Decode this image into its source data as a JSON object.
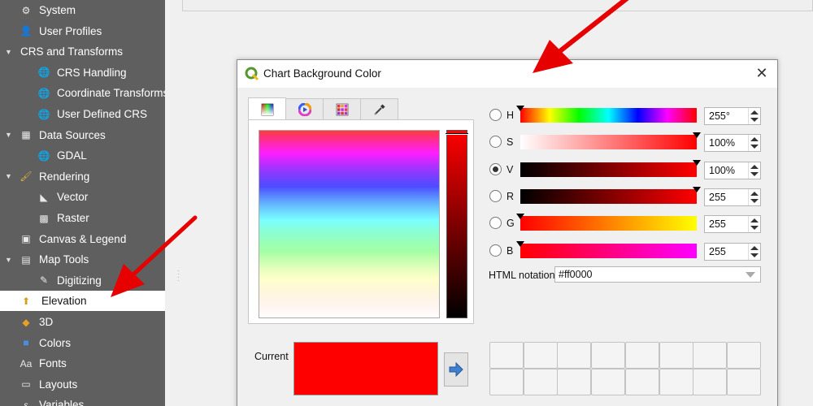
{
  "sidebar": {
    "items": [
      {
        "label": "System",
        "icon": "system-icon",
        "level": 1
      },
      {
        "label": "User Profiles",
        "icon": "user-icon",
        "level": 1
      },
      {
        "label": "CRS and Transforms",
        "icon": "none",
        "level": 0,
        "expanded": true
      },
      {
        "label": "CRS Handling",
        "icon": "globe-icon",
        "level": 2
      },
      {
        "label": "Coordinate Transforms",
        "icon": "globe-icon",
        "level": 2
      },
      {
        "label": "User Defined CRS",
        "icon": "globe-star-icon",
        "level": 2
      },
      {
        "label": "Data Sources",
        "icon": "table-icon",
        "level": 0,
        "expanded": true
      },
      {
        "label": "GDAL",
        "icon": "globe-icon",
        "level": 2
      },
      {
        "label": "Rendering",
        "icon": "brush-icon",
        "level": 0,
        "expanded": true
      },
      {
        "label": "Vector",
        "icon": "vector-icon",
        "level": 2
      },
      {
        "label": "Raster",
        "icon": "raster-icon",
        "level": 2
      },
      {
        "label": "Canvas & Legend",
        "icon": "canvas-icon",
        "level": 1
      },
      {
        "label": "Map Tools",
        "icon": "map-tools-icon",
        "level": 0,
        "expanded": true
      },
      {
        "label": "Digitizing",
        "icon": "digitizing-icon",
        "level": 2
      },
      {
        "label": "Elevation",
        "icon": "elevation-icon",
        "level": 1,
        "selected": true
      },
      {
        "label": "3D",
        "icon": "cube-icon",
        "level": 1
      },
      {
        "label": "Colors",
        "icon": "palette-icon",
        "level": 1
      },
      {
        "label": "Fonts",
        "icon": "font-icon",
        "level": 1
      },
      {
        "label": "Layouts",
        "icon": "layout-icon",
        "level": 1
      },
      {
        "label": "Variables",
        "icon": "variables-icon",
        "level": 1
      }
    ]
  },
  "dialog": {
    "title": "Chart Background Color",
    "close_glyph": "✕",
    "tabs": [
      {
        "name": "color-wheel-tab",
        "icon": "square-picker-icon",
        "active": true
      },
      {
        "name": "triangle-wheel-tab",
        "icon": "color-wheel-icon",
        "active": false
      },
      {
        "name": "swatches-tab",
        "icon": "swatch-grid-icon",
        "active": false
      },
      {
        "name": "sampler-tab",
        "icon": "eyedropper-icon",
        "active": false
      }
    ],
    "channels": [
      {
        "key": "H",
        "label": "H",
        "value": "255°",
        "checked": false,
        "level": 0.0
      },
      {
        "key": "S",
        "label": "S",
        "value": "100%",
        "checked": false,
        "level": 1.0
      },
      {
        "key": "V",
        "label": "V",
        "value": "100%",
        "checked": true,
        "level": 1.0
      },
      {
        "key": "R",
        "label": "R",
        "value": "255",
        "checked": false,
        "level": 1.0
      },
      {
        "key": "G",
        "label": "G",
        "value": "255",
        "checked": false,
        "level": 0.0
      },
      {
        "key": "B",
        "label": "B",
        "value": "255",
        "checked": false,
        "level": 0.0
      }
    ],
    "html_notation_label": "HTML notation",
    "html_notation_value": "#ff0000",
    "current_label": "Current",
    "current_color": "#ff0000",
    "accent_red": "#ff0000"
  }
}
